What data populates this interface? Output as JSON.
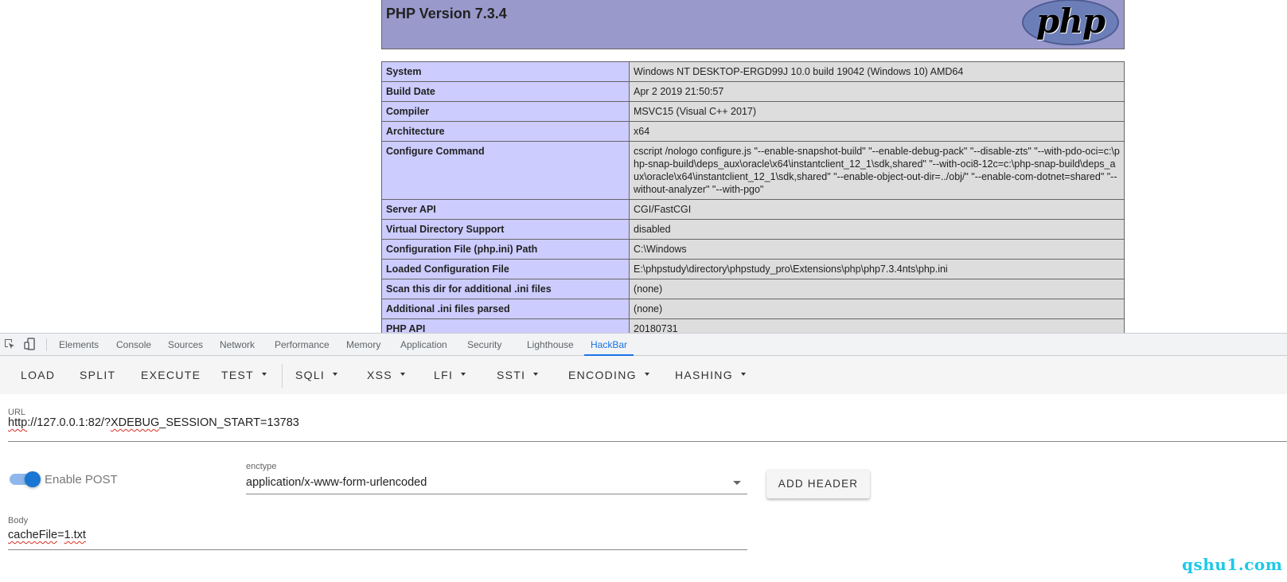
{
  "php": {
    "title": "PHP Version 7.3.4",
    "logo_text": "php",
    "rows": [
      {
        "key": "System",
        "value": "Windows NT DESKTOP-ERGD99J 10.0 build 19042 (Windows 10) AMD64"
      },
      {
        "key": "Build Date",
        "value": "Apr 2 2019 21:50:57"
      },
      {
        "key": "Compiler",
        "value": "MSVC15 (Visual C++ 2017)"
      },
      {
        "key": "Architecture",
        "value": "x64"
      },
      {
        "key": "Configure Command",
        "value": "cscript /nologo configure.js \"--enable-snapshot-build\" \"--enable-debug-pack\" \"--disable-zts\" \"--with-pdo-oci=c:\\php-snap-build\\deps_aux\\oracle\\x64\\instantclient_12_1\\sdk,shared\" \"--with-oci8-12c=c:\\php-snap-build\\deps_aux\\oracle\\x64\\instantclient_12_1\\sdk,shared\" \"--enable-object-out-dir=../obj/\" \"--enable-com-dotnet=shared\" \"--without-analyzer\" \"--with-pgo\""
      },
      {
        "key": "Server API",
        "value": "CGI/FastCGI"
      },
      {
        "key": "Virtual Directory Support",
        "value": "disabled"
      },
      {
        "key": "Configuration File (php.ini) Path",
        "value": "C:\\Windows"
      },
      {
        "key": "Loaded Configuration File",
        "value": "E:\\phpstudy\\directory\\phpstudy_pro\\Extensions\\php\\php7.3.4nts\\php.ini"
      },
      {
        "key": "Scan this dir for additional .ini files",
        "value": "(none)"
      },
      {
        "key": "Additional .ini files parsed",
        "value": "(none)"
      },
      {
        "key": "PHP API",
        "value": "20180731"
      }
    ]
  },
  "devtools": {
    "tabs": [
      "Elements",
      "Console",
      "Sources",
      "Network",
      "Performance",
      "Memory",
      "Application",
      "Security",
      "Lighthouse",
      "HackBar"
    ],
    "active_tab": "HackBar"
  },
  "hackbar": {
    "buttons": {
      "load": "LOAD",
      "split": "SPLIT",
      "execute": "EXECUTE",
      "test": "TEST",
      "sqli": "SQLI",
      "xss": "XSS",
      "lfi": "LFI",
      "ssti": "SSTI",
      "encoding": "ENCODING",
      "hashing": "HASHING"
    },
    "url_label": "URL",
    "url_part1": "http",
    "url_part2": "://127.0.0.1:82/?",
    "url_part3": "XDEBUG",
    "url_part4": "_SESSION_START=13783",
    "enable_post_label": "Enable POST",
    "enable_post": true,
    "enctype_label": "enctype",
    "enctype_value": "application/x-www-form-urlencoded",
    "add_header": "ADD HEADER",
    "body_label": "Body",
    "body_part1": "cacheFile",
    "body_part2": "=",
    "body_part3": "1.txt"
  },
  "watermark": "qshu1.com",
  "colors": {
    "php_header": "#9999cc",
    "php_key_bg": "#ccccff",
    "php_value_bg": "#dddddd",
    "active_tab": "#1a73e8",
    "toggle": "#1976d2",
    "watermark": "#1ec8e8"
  }
}
